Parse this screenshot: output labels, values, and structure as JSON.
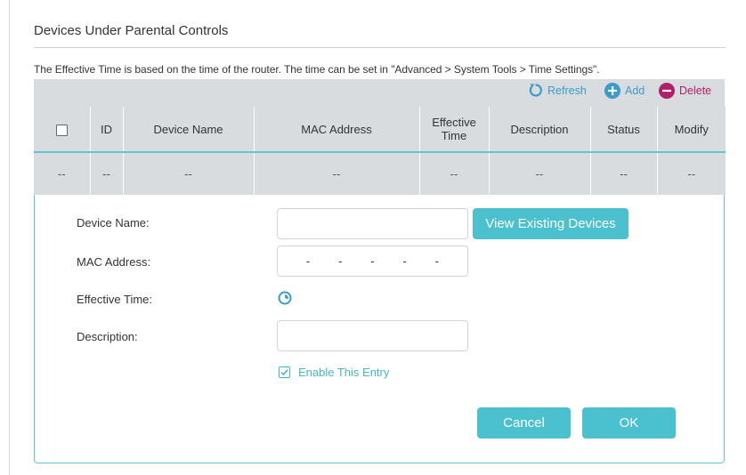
{
  "section_title": "Devices Under Parental Controls",
  "note": "The Effective Time is based on the time of the router. The time can be set in \"Advanced > System Tools > Time Settings\".",
  "toolbar": {
    "refresh_label": "Refresh",
    "add_label": "Add",
    "delete_label": "Delete"
  },
  "table": {
    "columns": [
      "ID",
      "Device Name",
      "MAC Address",
      "Effective\nTime",
      "Description",
      "Status",
      "Modify"
    ],
    "rows": [
      [
        "--",
        "--",
        "--",
        "--",
        "--",
        "--",
        "--",
        "--"
      ]
    ]
  },
  "form": {
    "device_name_label": "Device Name:",
    "device_name_value": "",
    "view_existing_label": "View Existing Devices",
    "mac_label": "MAC Address:",
    "mac_separators": [
      "-",
      "-",
      "-",
      "-",
      "-"
    ],
    "effective_time_label": "Effective Time:",
    "description_label": "Description:",
    "description_value": "",
    "enable_label": "Enable This Entry",
    "enable_checked": true,
    "cancel_label": "Cancel",
    "ok_label": "OK"
  },
  "colors": {
    "accent": "#4bc0cf",
    "link": "#3a9cc7",
    "delete": "#b0206a",
    "table_bg": "#d9dcdf"
  }
}
